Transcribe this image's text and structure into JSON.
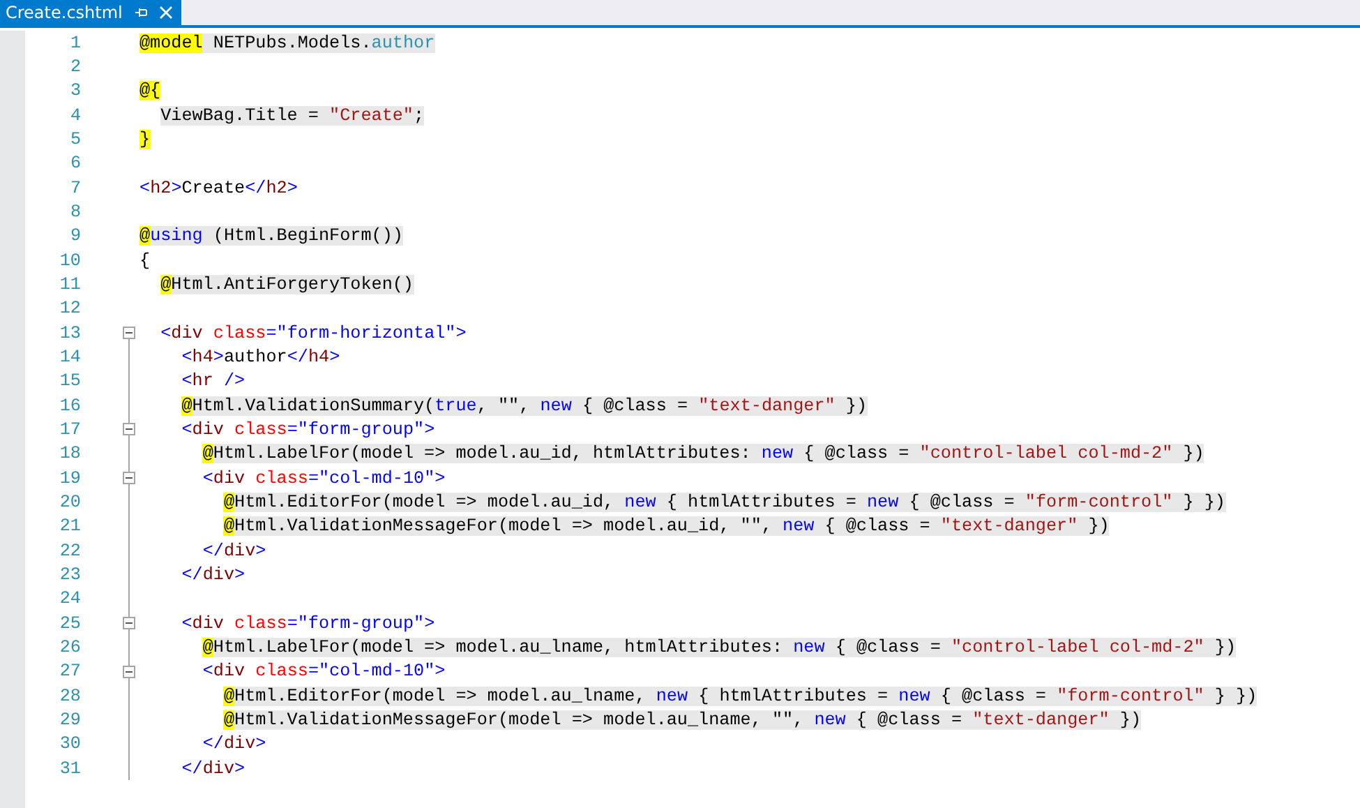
{
  "tab": {
    "title": "Create.cshtml",
    "selected": true
  },
  "lines": [
    {
      "n": "1",
      "csharp": true,
      "tokens": [
        {
          "kind": "marker",
          "text": "@model"
        },
        {
          "kind": "text",
          "text": " NETPubs.Models."
        },
        {
          "kind": "type",
          "text": "author"
        }
      ]
    },
    {
      "n": "2"
    },
    {
      "n": "3",
      "tokens": [
        {
          "kind": "marker",
          "text": "@{"
        }
      ],
      "children": [
        {
          "n": "4",
          "csharp": true,
          "tokens": [
            {
              "kind": "text",
              "text": "ViewBag.Title = "
            },
            {
              "kind": "str",
              "text": "\"Create\""
            },
            {
              "kind": "text",
              "text": ";"
            }
          ]
        }
      ]
    },
    {
      "n": "5",
      "tokens": [
        {
          "kind": "marker",
          "text": "}"
        }
      ]
    },
    {
      "n": "6"
    },
    {
      "n": "7",
      "tokens": [
        {
          "kind": "delim",
          "text": "<"
        },
        {
          "kind": "tag",
          "text": "h2"
        },
        {
          "kind": "delim",
          "text": ">"
        },
        {
          "kind": "text",
          "text": "Create"
        },
        {
          "kind": "delim",
          "text": "</"
        },
        {
          "kind": "tag",
          "text": "h2"
        },
        {
          "kind": "delim",
          "text": ">"
        }
      ]
    },
    {
      "n": "8"
    },
    {
      "n": "9",
      "csharp": true,
      "tokens": [
        {
          "kind": "marker",
          "text": "@"
        },
        {
          "kind": "kw",
          "text": "using"
        },
        {
          "kind": "text",
          "text": " (Html.BeginForm())"
        }
      ]
    },
    {
      "n": "10",
      "tokens": [
        {
          "kind": "text",
          "text": "{"
        }
      ],
      "children": [
        {
          "n": "11",
          "csharp": true,
          "tokens": [
            {
              "kind": "marker",
              "text": "@"
            },
            {
              "kind": "text",
              "text": "Html.AntiForgeryToken()"
            }
          ]
        },
        {
          "n": "12"
        },
        {
          "n": "13",
          "collapsible": true,
          "tokens": [
            {
              "kind": "delim",
              "text": "<"
            },
            {
              "kind": "tag",
              "text": "div "
            },
            {
              "kind": "attr",
              "text": "class"
            },
            {
              "kind": "delim",
              "text": "="
            },
            {
              "kind": "val",
              "text": "\"form-horizontal\""
            },
            {
              "kind": "delim",
              "text": ">"
            }
          ],
          "children": [
            {
              "n": "14",
              "tokens": [
                {
                  "kind": "delim",
                  "text": "<"
                },
                {
                  "kind": "tag",
                  "text": "h4"
                },
                {
                  "kind": "delim",
                  "text": ">"
                },
                {
                  "kind": "text",
                  "text": "author"
                },
                {
                  "kind": "delim",
                  "text": "</"
                },
                {
                  "kind": "tag",
                  "text": "h4"
                },
                {
                  "kind": "delim",
                  "text": ">"
                }
              ]
            },
            {
              "n": "15",
              "tokens": [
                {
                  "kind": "delim",
                  "text": "<"
                },
                {
                  "kind": "tag",
                  "text": "hr"
                },
                {
                  "kind": "delim",
                  "text": " />"
                }
              ]
            },
            {
              "n": "16",
              "csharp": true,
              "tokens": [
                {
                  "kind": "marker",
                  "text": "@"
                },
                {
                  "kind": "text",
                  "text": "Html.ValidationSummary("
                },
                {
                  "kind": "kw",
                  "text": "true"
                },
                {
                  "kind": "text",
                  "text": ", \"\", "
                },
                {
                  "kind": "kw",
                  "text": "new"
                },
                {
                  "kind": "text",
                  "text": " { @class = "
                },
                {
                  "kind": "str",
                  "text": "\"text-danger\""
                },
                {
                  "kind": "text",
                  "text": " })"
                }
              ]
            },
            {
              "n": "17",
              "collapsible": true,
              "tokens": [
                {
                  "kind": "delim",
                  "text": "<"
                },
                {
                  "kind": "tag",
                  "text": "div "
                },
                {
                  "kind": "attr",
                  "text": "class"
                },
                {
                  "kind": "delim",
                  "text": "="
                },
                {
                  "kind": "val",
                  "text": "\"form-group\""
                },
                {
                  "kind": "delim",
                  "text": ">"
                }
              ],
              "children": [
                {
                  "n": "18",
                  "csharp": true,
                  "tokens": [
                    {
                      "kind": "marker",
                      "text": "@"
                    },
                    {
                      "kind": "text",
                      "text": "Html.LabelFor(model => model.au_id, htmlAttributes: "
                    },
                    {
                      "kind": "kw",
                      "text": "new"
                    },
                    {
                      "kind": "text",
                      "text": " { @class = "
                    },
                    {
                      "kind": "str",
                      "text": "\"control-label col-md-2\""
                    },
                    {
                      "kind": "text",
                      "text": " })"
                    }
                  ]
                },
                {
                  "n": "19",
                  "collapsible": true,
                  "tokens": [
                    {
                      "kind": "delim",
                      "text": "<"
                    },
                    {
                      "kind": "tag",
                      "text": "div "
                    },
                    {
                      "kind": "attr",
                      "text": "class"
                    },
                    {
                      "kind": "delim",
                      "text": "="
                    },
                    {
                      "kind": "val",
                      "text": "\"col-md-10\""
                    },
                    {
                      "kind": "delim",
                      "text": ">"
                    }
                  ],
                  "children": [
                    {
                      "n": "20",
                      "csharp": true,
                      "tokens": [
                        {
                          "kind": "marker",
                          "text": "@"
                        },
                        {
                          "kind": "text",
                          "text": "Html.EditorFor(model => model.au_id, "
                        },
                        {
                          "kind": "kw",
                          "text": "new"
                        },
                        {
                          "kind": "text",
                          "text": " { htmlAttributes = "
                        },
                        {
                          "kind": "kw",
                          "text": "new"
                        },
                        {
                          "kind": "text",
                          "text": " { @class = "
                        },
                        {
                          "kind": "str",
                          "text": "\"form-control\""
                        },
                        {
                          "kind": "text",
                          "text": " } })"
                        }
                      ]
                    },
                    {
                      "n": "21",
                      "csharp": true,
                      "tokens": [
                        {
                          "kind": "marker",
                          "text": "@"
                        },
                        {
                          "kind": "text",
                          "text": "Html.ValidationMessageFor(model => model.au_id, \"\", "
                        },
                        {
                          "kind": "kw",
                          "text": "new"
                        },
                        {
                          "kind": "text",
                          "text": " { @class = "
                        },
                        {
                          "kind": "str",
                          "text": "\"text-danger\""
                        },
                        {
                          "kind": "text",
                          "text": " })"
                        }
                      ]
                    }
                  ]
                },
                {
                  "n": "22",
                  "tokens": [
                    {
                      "kind": "delim",
                      "text": "</"
                    },
                    {
                      "kind": "tag",
                      "text": "div"
                    },
                    {
                      "kind": "delim",
                      "text": ">"
                    }
                  ]
                }
              ]
            },
            {
              "n": "23",
              "tokens": [
                {
                  "kind": "delim",
                  "text": "</"
                },
                {
                  "kind": "tag",
                  "text": "div"
                },
                {
                  "kind": "delim",
                  "text": ">"
                }
              ]
            },
            {
              "n": "24"
            },
            {
              "n": "25",
              "collapsible": true,
              "tokens": [
                {
                  "kind": "delim",
                  "text": "<"
                },
                {
                  "kind": "tag",
                  "text": "div "
                },
                {
                  "kind": "attr",
                  "text": "class"
                },
                {
                  "kind": "delim",
                  "text": "="
                },
                {
                  "kind": "val",
                  "text": "\"form-group\""
                },
                {
                  "kind": "delim",
                  "text": ">"
                }
              ],
              "children": [
                {
                  "n": "26",
                  "csharp": true,
                  "tokens": [
                    {
                      "kind": "marker",
                      "text": "@"
                    },
                    {
                      "kind": "text",
                      "text": "Html.LabelFor(model => model.au_lname, htmlAttributes: "
                    },
                    {
                      "kind": "kw",
                      "text": "new"
                    },
                    {
                      "kind": "text",
                      "text": " { @class = "
                    },
                    {
                      "kind": "str",
                      "text": "\"control-label col-md-2\""
                    },
                    {
                      "kind": "text",
                      "text": " })"
                    }
                  ]
                },
                {
                  "n": "27",
                  "collapsible": true,
                  "tokens": [
                    {
                      "kind": "delim",
                      "text": "<"
                    },
                    {
                      "kind": "tag",
                      "text": "div "
                    },
                    {
                      "kind": "attr",
                      "text": "class"
                    },
                    {
                      "kind": "delim",
                      "text": "="
                    },
                    {
                      "kind": "val",
                      "text": "\"col-md-10\""
                    },
                    {
                      "kind": "delim",
                      "text": ">"
                    }
                  ],
                  "children": [
                    {
                      "n": "28",
                      "csharp": true,
                      "tokens": [
                        {
                          "kind": "marker",
                          "text": "@"
                        },
                        {
                          "kind": "text",
                          "text": "Html.EditorFor(model => model.au_lname, "
                        },
                        {
                          "kind": "kw",
                          "text": "new"
                        },
                        {
                          "kind": "text",
                          "text": " { htmlAttributes = "
                        },
                        {
                          "kind": "kw",
                          "text": "new"
                        },
                        {
                          "kind": "text",
                          "text": " { @class = "
                        },
                        {
                          "kind": "str",
                          "text": "\"form-control\""
                        },
                        {
                          "kind": "text",
                          "text": " } })"
                        }
                      ]
                    },
                    {
                      "n": "29",
                      "csharp": true,
                      "tokens": [
                        {
                          "kind": "marker",
                          "text": "@"
                        },
                        {
                          "kind": "text",
                          "text": "Html.ValidationMessageFor(model => model.au_lname, \"\", "
                        },
                        {
                          "kind": "kw",
                          "text": "new"
                        },
                        {
                          "kind": "text",
                          "text": " { @class = "
                        },
                        {
                          "kind": "str",
                          "text": "\"text-danger\""
                        },
                        {
                          "kind": "text",
                          "text": " })"
                        }
                      ]
                    }
                  ]
                },
                {
                  "n": "30",
                  "tokens": [
                    {
                      "kind": "delim",
                      "text": "</"
                    },
                    {
                      "kind": "tag",
                      "text": "div"
                    },
                    {
                      "kind": "delim",
                      "text": ">"
                    }
                  ]
                }
              ]
            },
            {
              "n": "31",
              "tokens": [
                {
                  "kind": "delim",
                  "text": "</"
                },
                {
                  "kind": "tag",
                  "text": "div"
                },
                {
                  "kind": "delim",
                  "text": ">"
                }
              ]
            }
          ]
        }
      ]
    }
  ]
}
